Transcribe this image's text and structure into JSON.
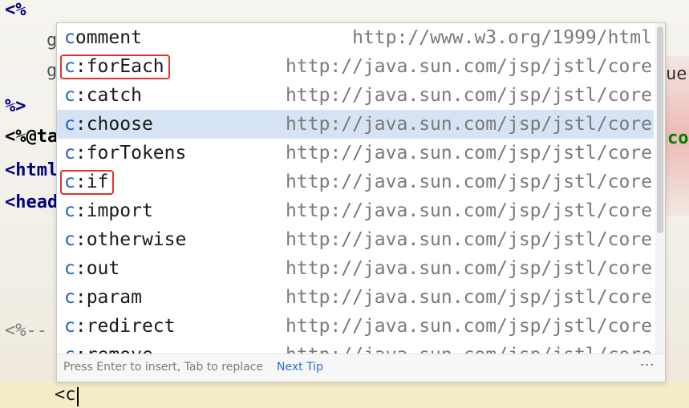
{
  "editor": {
    "line1": "<%",
    "line_g1": "g",
    "line_g2": "g",
    "line_ue": "ue",
    "line_close": "%>",
    "line_taglib": "<%@ta",
    "line_co": "co",
    "line_html": "<html",
    "line_head": "<head",
    "line_tab1": "↳",
    "line_comment": "<%--",
    "current_line": "<c"
  },
  "completion": {
    "items": [
      {
        "name_match": "c",
        "name_rest": "omment",
        "url": "http://www.w3.org/1999/html"
      },
      {
        "name_match": "c",
        "name_rest": ":forEach",
        "url": "http://java.sun.com/jsp/jstl/core"
      },
      {
        "name_match": "c",
        "name_rest": ":catch",
        "url": "http://java.sun.com/jsp/jstl/core"
      },
      {
        "name_match": "c",
        "name_rest": ":choose",
        "url": "http://java.sun.com/jsp/jstl/core"
      },
      {
        "name_match": "c",
        "name_rest": ":forTokens",
        "url": "http://java.sun.com/jsp/jstl/core"
      },
      {
        "name_match": "c",
        "name_rest": ":if",
        "url": "http://java.sun.com/jsp/jstl/core"
      },
      {
        "name_match": "c",
        "name_rest": ":import",
        "url": "http://java.sun.com/jsp/jstl/core"
      },
      {
        "name_match": "c",
        "name_rest": ":otherwise",
        "url": "http://java.sun.com/jsp/jstl/core"
      },
      {
        "name_match": "c",
        "name_rest": ":out",
        "url": "http://java.sun.com/jsp/jstl/core"
      },
      {
        "name_match": "c",
        "name_rest": ":param",
        "url": "http://java.sun.com/jsp/jstl/core"
      },
      {
        "name_match": "c",
        "name_rest": ":redirect",
        "url": "http://java.sun.com/jsp/jstl/core"
      },
      {
        "name_match": "c",
        "name_rest": ":remove",
        "url": "http://java.sun.com/jsp/jstl/core"
      }
    ],
    "selected_index": 3,
    "highlighted_items": [
      1,
      5
    ],
    "footer_hint": "Press Enter to insert, Tab to replace",
    "footer_tip": "Next Tip",
    "more_icon": "⋮"
  },
  "colors": {
    "match": "#1f63c6",
    "selected_bg": "#d6e3f5",
    "highlight_border": "#e0342c"
  }
}
